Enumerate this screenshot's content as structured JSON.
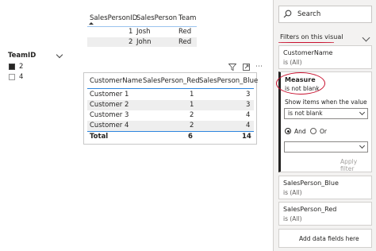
{
  "top_table": {
    "headers": [
      "SalesPersonID",
      "SalesPerson",
      "Team"
    ],
    "rows": [
      [
        "1",
        "Josh",
        "Red"
      ],
      [
        "2",
        "John",
        "Red"
      ]
    ]
  },
  "slicer": {
    "title": "TeamID",
    "items": [
      {
        "label": "2",
        "checked": true
      },
      {
        "label": "4",
        "checked": false
      }
    ]
  },
  "main_table": {
    "headers": [
      "CustomerName",
      "SalesPerson_Red",
      "SalesPerson_Blue"
    ],
    "rows": [
      [
        "Customer 1",
        "1",
        "3"
      ],
      [
        "Customer 2",
        "1",
        "3"
      ],
      [
        "Customer 3",
        "2",
        "4"
      ],
      [
        "Customer 4",
        "2",
        "4"
      ]
    ],
    "total": [
      "Total",
      "6",
      "14"
    ]
  },
  "filters_pane": {
    "search_placeholder": "Search",
    "section_title": "Filters on this visual",
    "filters": [
      {
        "name": "CustomerName",
        "state": "is (All)"
      },
      {
        "name": "Measure",
        "state": "is not blank"
      },
      {
        "name": "SalesPerson_Blue",
        "state": "is (All)"
      },
      {
        "name": "SalesPerson_Red",
        "state": "is (All)"
      }
    ],
    "show_items_label": "Show items when the value",
    "condition_value": "is not blank",
    "and_label": "And",
    "or_label": "Or",
    "apply_label": "Apply filter",
    "add_data_label": "Add data fields here"
  },
  "colors": {
    "accent_red": "#c8102e",
    "table_divider": "#2e86de",
    "pane_bg": "#f3f2f1"
  }
}
